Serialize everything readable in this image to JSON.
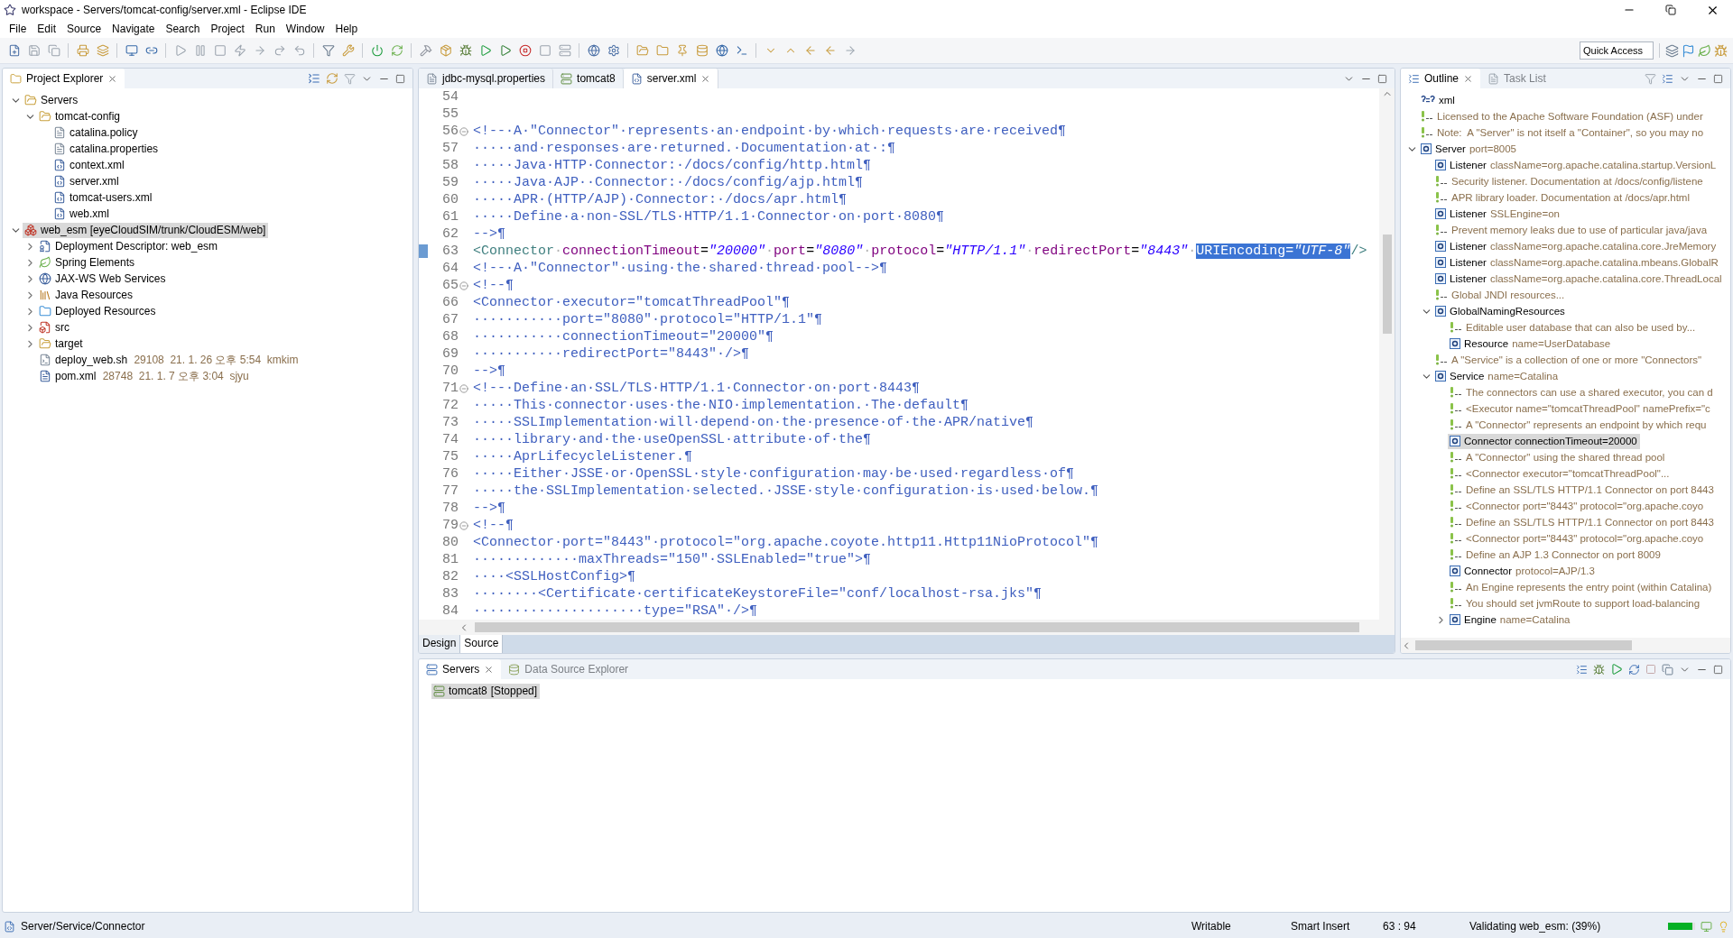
{
  "window": {
    "title": "workspace - Servers/tomcat-config/server.xml - Eclipse IDE"
  },
  "menu": [
    "File",
    "Edit",
    "Source",
    "Navigate",
    "Search",
    "Project",
    "Run",
    "Window",
    "Help"
  ],
  "quick_access": {
    "placeholder": "Quick Access"
  },
  "explorer": {
    "title": "Project Explorer",
    "items": [
      {
        "label": "Servers",
        "kind": "folder",
        "expanded": true,
        "selected": false,
        "children": [
          {
            "label": "tomcat-config",
            "kind": "folder",
            "expanded": true,
            "selected": false,
            "children": [
              {
                "label": "catalina.policy",
                "kind": "file",
                "selected": false
              },
              {
                "label": "catalina.properties",
                "kind": "file",
                "selected": false
              },
              {
                "label": "context.xml",
                "kind": "xml",
                "selected": false
              },
              {
                "label": "server.xml",
                "kind": "xml",
                "selected": false
              },
              {
                "label": "tomcat-users.xml",
                "kind": "xml",
                "selected": false
              },
              {
                "label": "web.xml",
                "kind": "xml",
                "selected": false
              }
            ]
          }
        ]
      },
      {
        "label": "web_esm [eyeCloudSIM/trunk/CloudESM/web]",
        "kind": "project",
        "expanded": true,
        "selected": true,
        "children": [
          {
            "label": "Deployment Descriptor: web_esm",
            "kind": "descriptor",
            "expanded": false,
            "selected": false
          },
          {
            "label": "Spring Elements",
            "kind": "spring",
            "expanded": false,
            "selected": false
          },
          {
            "label": "JAX-WS Web Services",
            "kind": "webservice",
            "expanded": false,
            "selected": false
          },
          {
            "label": "Java Resources",
            "kind": "library",
            "expanded": false,
            "selected": false
          },
          {
            "label": "Deployed Resources",
            "kind": "deployed",
            "expanded": false,
            "selected": false
          },
          {
            "label": "src",
            "kind": "src",
            "expanded": false,
            "selected": false
          },
          {
            "label": "target",
            "kind": "folder",
            "expanded": false,
            "selected": false
          },
          {
            "label": "deploy_web.sh",
            "kind": "script",
            "info": "29108  21. 1. 26 오후 5:54  kmkim",
            "selected": false
          },
          {
            "label": "pom.xml",
            "kind": "pom",
            "info": "28748  21. 1. 7 오후 3:04  sjyu",
            "selected": false
          }
        ]
      }
    ]
  },
  "editor": {
    "tabs": [
      {
        "label": "jdbc-mysql.properties",
        "kind": "properties",
        "selected": false
      },
      {
        "label": "tomcat8",
        "kind": "server",
        "selected": false
      },
      {
        "label": "server.xml",
        "kind": "xml",
        "selected": true
      }
    ],
    "lines": [
      {
        "number": "54",
        "foldable": false,
        "marked": false
      },
      {
        "number": "55",
        "foldable": false,
        "marked": false
      },
      {
        "number": "56",
        "foldable": true,
        "marked": false,
        "segments": [
          {
            "kind": "comment",
            "text": "<!--·A·\"Connector\"·represents·an·endpoint·by·which·requests·are·received¶",
            "selected": false
          }
        ]
      },
      {
        "number": "57",
        "foldable": false,
        "marked": false,
        "segments": [
          {
            "kind": "comment",
            "text": "·····and·responses·are·returned.·Documentation·at·:¶",
            "selected": false
          }
        ]
      },
      {
        "number": "58",
        "foldable": false,
        "marked": false,
        "segments": [
          {
            "kind": "comment",
            "text": "·····Java·HTTP·Connector:·/docs/config/http.html¶",
            "selected": false
          }
        ]
      },
      {
        "number": "59",
        "foldable": false,
        "marked": false,
        "segments": [
          {
            "kind": "comment",
            "text": "·····Java·AJP··Connector:·/docs/config/ajp.html¶",
            "selected": false
          }
        ]
      },
      {
        "number": "60",
        "foldable": false,
        "marked": false,
        "segments": [
          {
            "kind": "comment",
            "text": "·····APR·(HTTP/AJP)·Connector:·/docs/apr.html¶",
            "selected": false
          }
        ]
      },
      {
        "number": "61",
        "foldable": false,
        "marked": false,
        "segments": [
          {
            "kind": "comment",
            "text": "·····Define·a·non-SSL/TLS·HTTP/1.1·Connector·on·port·8080¶",
            "selected": false
          }
        ]
      },
      {
        "number": "62",
        "foldable": false,
        "marked": false,
        "segments": [
          {
            "kind": "comment",
            "text": "-->¶",
            "selected": false
          }
        ]
      },
      {
        "number": "63",
        "foldable": false,
        "marked": true,
        "segments": [
          {
            "kind": "tag",
            "text": "<Connector",
            "selected": false
          },
          {
            "kind": "space",
            "text": "·",
            "selected": false
          },
          {
            "kind": "attr",
            "text": "connectionTimeout",
            "selected": false
          },
          {
            "kind": "punct",
            "text": "=",
            "selected": false
          },
          {
            "kind": "value",
            "text": "\"20000\"",
            "selected": false
          },
          {
            "kind": "space",
            "text": "·",
            "selected": false
          },
          {
            "kind": "attr",
            "text": "port",
            "selected": false
          },
          {
            "kind": "punct",
            "text": "=",
            "selected": false
          },
          {
            "kind": "value",
            "text": "\"8080\"",
            "selected": false
          },
          {
            "kind": "space",
            "text": "·",
            "selected": false
          },
          {
            "kind": "attr",
            "text": "protocol",
            "selected": false
          },
          {
            "kind": "punct",
            "text": "=",
            "selected": false
          },
          {
            "kind": "value",
            "text": "\"HTTP/1.1\"",
            "selected": false
          },
          {
            "kind": "space",
            "text": "·",
            "selected": false
          },
          {
            "kind": "attr",
            "text": "redirectPort",
            "selected": false
          },
          {
            "kind": "punct",
            "text": "=",
            "selected": false
          },
          {
            "kind": "value",
            "text": "\"8443\"",
            "selected": false
          },
          {
            "kind": "space",
            "text": "·",
            "selected": false
          },
          {
            "kind": "attr",
            "text": "URIEncoding",
            "selected": true
          },
          {
            "kind": "punct",
            "text": "=",
            "selected": true
          },
          {
            "kind": "value",
            "text": "\"UTF-8\"",
            "selected": true
          },
          {
            "kind": "tag",
            "text": "/>",
            "selected": false
          }
        ]
      },
      {
        "number": "64",
        "foldable": false,
        "marked": false,
        "segments": [
          {
            "kind": "comment",
            "text": "<!--·A·\"Connector\"·using·the·shared·thread·pool-->¶",
            "selected": false
          }
        ]
      },
      {
        "number": "65",
        "foldable": true,
        "marked": false,
        "segments": [
          {
            "kind": "comment",
            "text": "<!--¶",
            "selected": false
          }
        ]
      },
      {
        "number": "66",
        "foldable": false,
        "marked": false,
        "segments": [
          {
            "kind": "comment",
            "text": "<Connector·executor=\"tomcatThreadPool\"¶",
            "selected": false
          }
        ]
      },
      {
        "number": "67",
        "foldable": false,
        "marked": false,
        "segments": [
          {
            "kind": "comment",
            "text": "···········port=\"8080\"·protocol=\"HTTP/1.1\"¶",
            "selected": false
          }
        ]
      },
      {
        "number": "68",
        "foldable": false,
        "marked": false,
        "segments": [
          {
            "kind": "comment",
            "text": "···········connectionTimeout=\"20000\"¶",
            "selected": false
          }
        ]
      },
      {
        "number": "69",
        "foldable": false,
        "marked": false,
        "segments": [
          {
            "kind": "comment",
            "text": "···········redirectPort=\"8443\"·/>¶",
            "selected": false
          }
        ]
      },
      {
        "number": "70",
        "foldable": false,
        "marked": false,
        "segments": [
          {
            "kind": "comment",
            "text": "-->¶",
            "selected": false
          }
        ]
      },
      {
        "number": "71",
        "foldable": true,
        "marked": false,
        "segments": [
          {
            "kind": "comment",
            "text": "<!--·Define·an·SSL/TLS·HTTP/1.1·Connector·on·port·8443¶",
            "selected": false
          }
        ]
      },
      {
        "number": "72",
        "foldable": false,
        "marked": false,
        "segments": [
          {
            "kind": "comment",
            "text": "·····This·connector·uses·the·NIO·implementation.·The·default¶",
            "selected": false
          }
        ]
      },
      {
        "number": "73",
        "foldable": false,
        "marked": false,
        "segments": [
          {
            "kind": "comment",
            "text": "·····SSLImplementation·will·depend·on·the·presence·of·the·APR/native¶",
            "selected": false
          }
        ]
      },
      {
        "number": "74",
        "foldable": false,
        "marked": false,
        "segments": [
          {
            "kind": "comment",
            "text": "·····library·and·the·useOpenSSL·attribute·of·the¶",
            "selected": false
          }
        ]
      },
      {
        "number": "75",
        "foldable": false,
        "marked": false,
        "segments": [
          {
            "kind": "comment",
            "text": "·····AprLifecycleListener.¶",
            "selected": false
          }
        ]
      },
      {
        "number": "76",
        "foldable": false,
        "marked": false,
        "segments": [
          {
            "kind": "comment",
            "text": "·····Either·JSSE·or·OpenSSL·style·configuration·may·be·used·regardless·of¶",
            "selected": false
          }
        ]
      },
      {
        "number": "77",
        "foldable": false,
        "marked": false,
        "segments": [
          {
            "kind": "comment",
            "text": "·····the·SSLImplementation·selected.·JSSE·style·configuration·is·used·below.¶",
            "selected": false
          }
        ]
      },
      {
        "number": "78",
        "foldable": false,
        "marked": false,
        "segments": [
          {
            "kind": "comment",
            "text": "-->¶",
            "selected": false
          }
        ]
      },
      {
        "number": "79",
        "foldable": true,
        "marked": false,
        "segments": [
          {
            "kind": "comment",
            "text": "<!--¶",
            "selected": false
          }
        ]
      },
      {
        "number": "80",
        "foldable": false,
        "marked": false,
        "segments": [
          {
            "kind": "comment",
            "text": "<Connector·port=\"8443\"·protocol=\"org.apache.coyote.http11.Http11NioProtocol\"¶",
            "selected": false
          }
        ]
      },
      {
        "number": "81",
        "foldable": false,
        "marked": false,
        "segments": [
          {
            "kind": "comment",
            "text": "·············maxThreads=\"150\"·SSLEnabled=\"true\">¶",
            "selected": false
          }
        ]
      },
      {
        "number": "82",
        "foldable": false,
        "marked": false,
        "segments": [
          {
            "kind": "comment",
            "text": "····<SSLHostConfig>¶",
            "selected": false
          }
        ]
      },
      {
        "number": "83",
        "foldable": false,
        "marked": false,
        "segments": [
          {
            "kind": "comment",
            "text": "········<Certificate·certificateKeystoreFile=\"conf/localhost-rsa.jks\"¶",
            "selected": false
          }
        ]
      },
      {
        "number": "84",
        "foldable": false,
        "marked": false,
        "segments": [
          {
            "kind": "comment",
            "text": "·····················type=\"RSA\"·/>¶",
            "selected": false
          }
        ]
      }
    ],
    "mode_tabs": [
      {
        "label": "Design",
        "selected": false
      },
      {
        "label": "Source",
        "selected": true
      }
    ]
  },
  "outline": {
    "tabs": [
      {
        "label": "Outline",
        "selected": true
      },
      {
        "label": "Task List",
        "selected": false
      }
    ],
    "items": [
      {
        "kind": "pi",
        "name": "xml",
        "selected": false
      },
      {
        "kind": "comment",
        "name": "Licensed to the Apache Software Foundation (ASF) under",
        "selected": false
      },
      {
        "kind": "comment",
        "name": "Note:  A \"Server\" is not itself a \"Container\", so you may no",
        "selected": false
      },
      {
        "kind": "element",
        "name": "Server",
        "detail": "port=8005",
        "expanded": true,
        "selected": false,
        "children": [
          {
            "kind": "element",
            "name": "Listener",
            "detail": "className=org.apache.catalina.startup.VersionL",
            "selected": false
          },
          {
            "kind": "comment",
            "name": "Security listener. Documentation at /docs/config/listene",
            "selected": false
          },
          {
            "kind": "comment",
            "name": "APR library loader. Documentation at /docs/apr.html",
            "selected": false
          },
          {
            "kind": "element",
            "name": "Listener",
            "detail": "SSLEngine=on",
            "selected": false
          },
          {
            "kind": "comment",
            "name": "Prevent memory leaks due to use of particular java/java",
            "selected": false
          },
          {
            "kind": "element",
            "name": "Listener",
            "detail": "className=org.apache.catalina.core.JreMemory",
            "selected": false
          },
          {
            "kind": "element",
            "name": "Listener",
            "detail": "className=org.apache.catalina.mbeans.GlobalR",
            "selected": false
          },
          {
            "kind": "element",
            "name": "Listener",
            "detail": "className=org.apache.catalina.core.ThreadLocal",
            "selected": false
          },
          {
            "kind": "comment",
            "name": "Global JNDI resources...",
            "selected": false
          },
          {
            "kind": "element",
            "name": "GlobalNamingResources",
            "expanded": true,
            "selected": false,
            "children": [
              {
                "kind": "comment",
                "name": "Editable user database that can also be used by...",
                "selected": false
              },
              {
                "kind": "element",
                "name": "Resource",
                "detail": "name=UserDatabase",
                "selected": false
              }
            ]
          },
          {
            "kind": "comment",
            "name": "A \"Service\" is a collection of one or more \"Connectors\"",
            "selected": false
          },
          {
            "kind": "element",
            "name": "Service",
            "detail": "name=Catalina",
            "expanded": true,
            "selected": false,
            "children": [
              {
                "kind": "comment",
                "name": "The connectors can use a shared executor, you can d",
                "selected": false
              },
              {
                "kind": "comment",
                "name": "<Executor name=\"tomcatThreadPool\" namePrefix=\"c",
                "selected": false
              },
              {
                "kind": "comment",
                "name": "A \"Connector\" represents an endpoint by which requ",
                "selected": false
              },
              {
                "kind": "element",
                "name": "Connector connectionTimeout=20000",
                "selected": true
              },
              {
                "kind": "comment",
                "name": "A \"Connector\" using the shared thread pool",
                "selected": false
              },
              {
                "kind": "comment",
                "name": "<Connector executor=\"tomcatThreadPool\"...",
                "selected": false
              },
              {
                "kind": "comment",
                "name": "Define an SSL/TLS HTTP/1.1 Connector on port 8443",
                "selected": false
              },
              {
                "kind": "comment",
                "name": "<Connector port=\"8443\" protocol=\"org.apache.coyo",
                "selected": false
              },
              {
                "kind": "comment",
                "name": "Define an SSL/TLS HTTP/1.1 Connector on port 8443",
                "selected": false
              },
              {
                "kind": "comment",
                "name": "<Connector port=\"8443\" protocol=\"org.apache.coyo",
                "selected": false
              },
              {
                "kind": "comment",
                "name": "Define an AJP 1.3 Connector on port 8009",
                "selected": false
              },
              {
                "kind": "element",
                "name": "Connector",
                "detail": "protocol=AJP/1.3",
                "selected": false
              },
              {
                "kind": "comment",
                "name": "An Engine represents the entry point (within Catalina)",
                "selected": false
              },
              {
                "kind": "comment",
                "name": "You should set jvmRoute to support load-balancing",
                "selected": false
              },
              {
                "kind": "element",
                "name": "Engine",
                "detail": "name=Catalina",
                "expanded": false,
                "selected": false
              }
            ]
          }
        ]
      }
    ]
  },
  "servers": {
    "tabs": [
      {
        "label": "Servers",
        "selected": true
      },
      {
        "label": "Data Source Explorer",
        "selected": false
      }
    ],
    "items": [
      {
        "label": "tomcat8",
        "state": "[Stopped]",
        "selected": true
      }
    ]
  },
  "status_bar": {
    "path": "Server/Service/Connector",
    "writable": "Writable",
    "insert_mode": "Smart Insert",
    "position": "63 : 94",
    "job": "Validating web_esm: (39%)",
    "level": 0.9
  }
}
